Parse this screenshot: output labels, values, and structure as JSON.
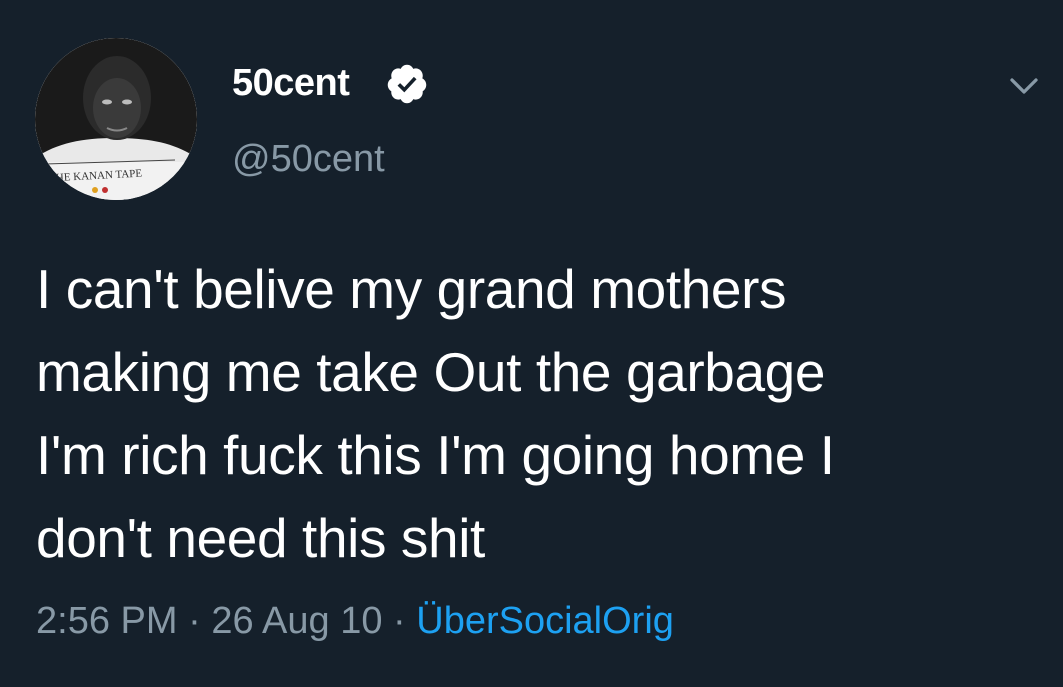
{
  "tweet": {
    "display_name": "50cent",
    "handle": "@50cent",
    "verified": true,
    "text": "I can't belive my grand mothers\nmaking me take Out the garbage\nI'm rich fuck this I'm going home I\ndon't need this shit",
    "time": "2:56 PM",
    "separator": "·",
    "date": "26 Aug 10",
    "source": "ÜberSocialOrig"
  },
  "avatar": {
    "caption": "THE KANAN TAPE"
  },
  "icons": {
    "verified": "verified-badge-icon",
    "menu": "chevron-down-icon"
  },
  "colors": {
    "background": "#15202b",
    "text": "#ffffff",
    "secondary": "#8899a6",
    "link": "#1da1f2"
  }
}
